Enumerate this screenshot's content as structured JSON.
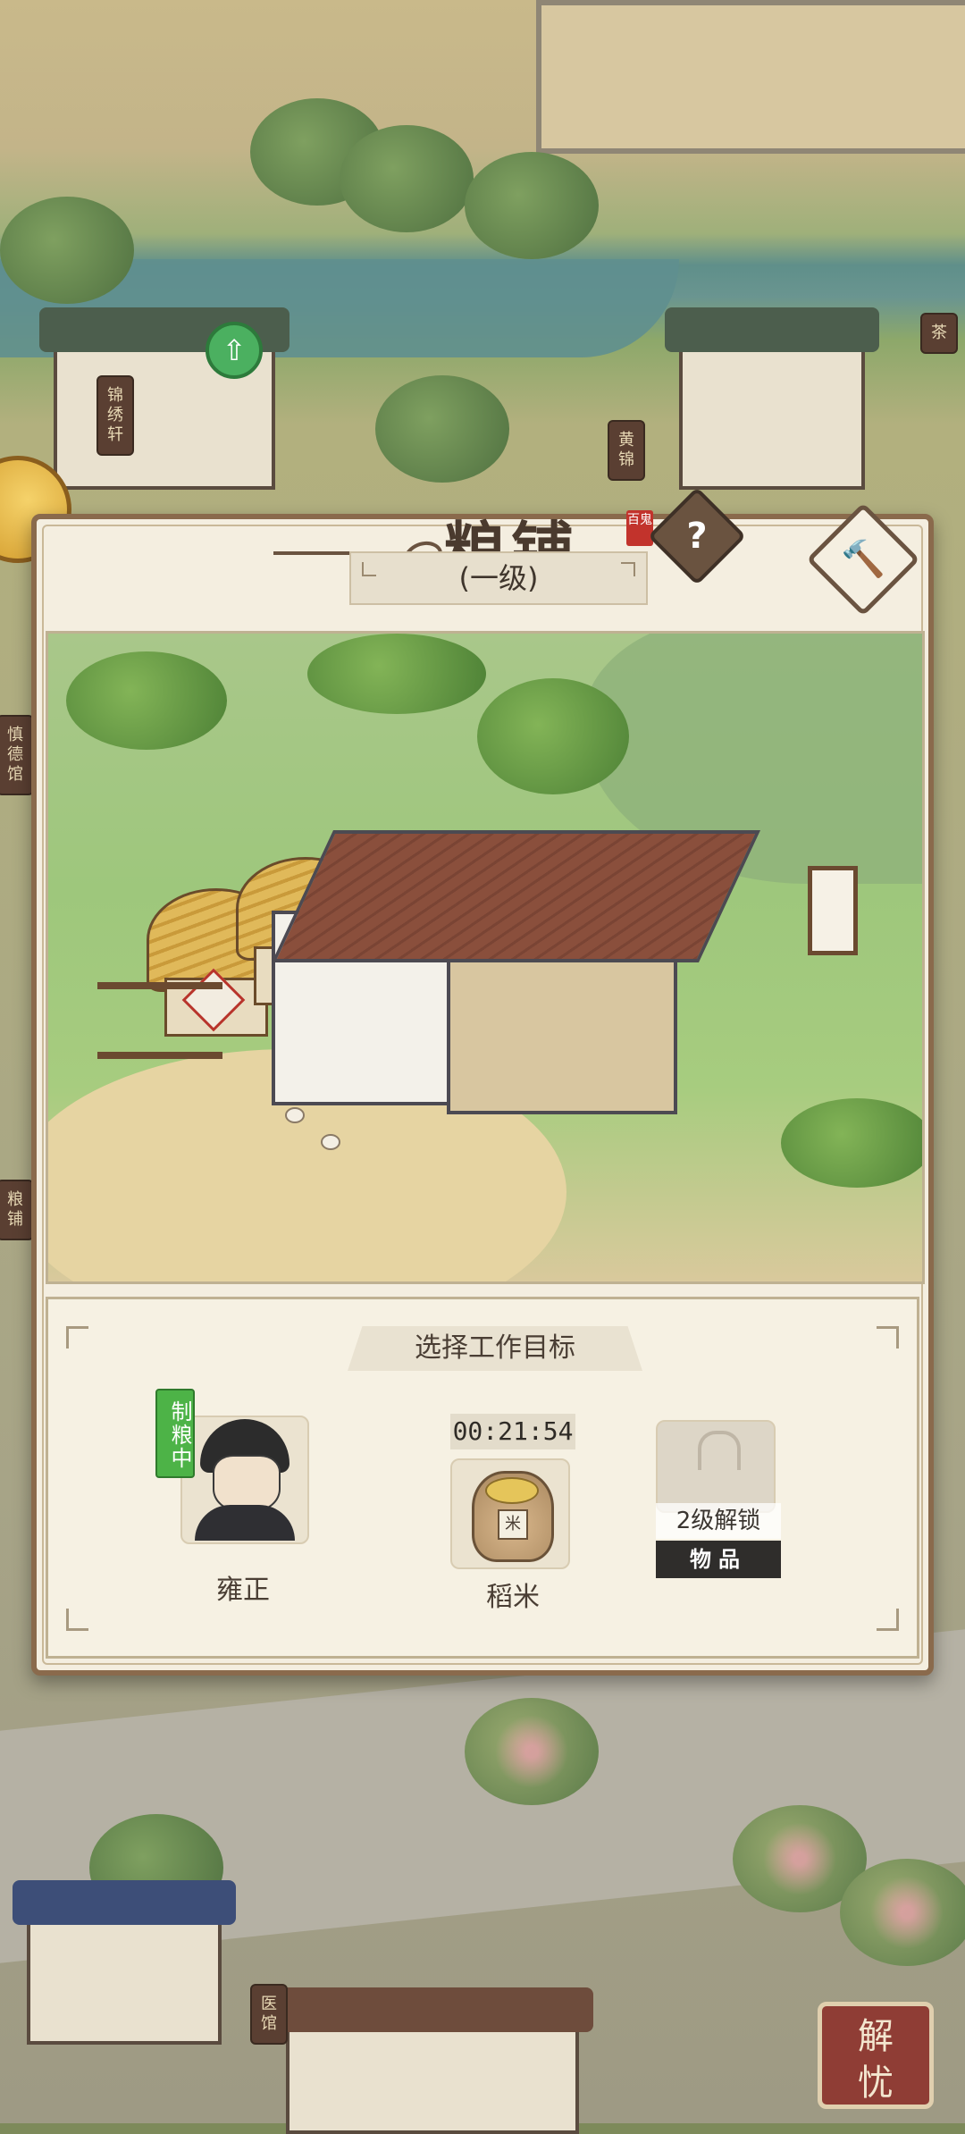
{
  "dialog": {
    "title": "粮铺",
    "title_stamp": "百鬼",
    "level": "(一级)",
    "help_label": "?",
    "work_panel": {
      "header": "选择工作目标",
      "worker": {
        "name": "雍正",
        "status": "制粮中"
      },
      "product": {
        "timer": "00:21:54",
        "name": "稻米",
        "sack_label": "米"
      },
      "locked_slot": {
        "unlock_text": "2级解锁",
        "type_label": "物品"
      }
    }
  },
  "world": {
    "side_signs": [
      "锦绣轩",
      "慎德馆",
      "粮铺",
      "黄锦",
      "茶",
      "医馆"
    ],
    "jieyou_button": [
      "解",
      "忧"
    ]
  }
}
